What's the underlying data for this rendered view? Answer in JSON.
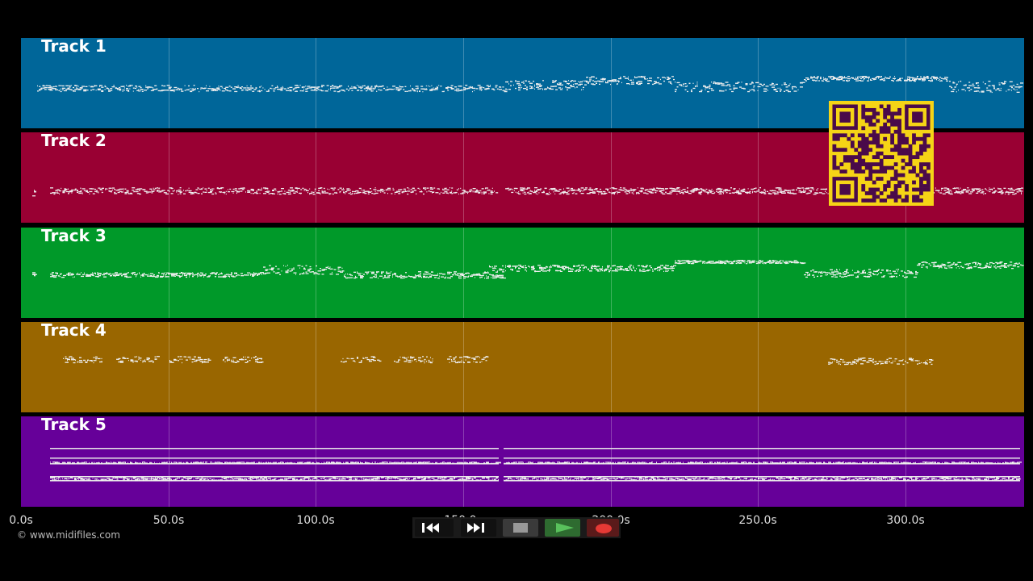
{
  "tracks": [
    {
      "label": "Track 1",
      "color": "#006699"
    },
    {
      "label": "Track 2",
      "color": "#990033"
    },
    {
      "label": "Track 3",
      "color": "#009929"
    },
    {
      "label": "Track 4",
      "color": "#996600"
    },
    {
      "label": "Track 5",
      "color": "#660099"
    }
  ],
  "timeline": {
    "ticks": [
      "0.0s",
      "50.0s",
      "100.0s",
      "150.0s",
      "200.0s",
      "250.0s",
      "300.0s"
    ]
  },
  "footer": {
    "copyright": "© www.midifiles.com"
  },
  "transport": {
    "rewind_icon": "rewind-icon",
    "forward_icon": "fast-forward-icon",
    "stop_icon": "stop-icon",
    "play_icon": "play-icon",
    "record_icon": "record-icon",
    "play_color": "#4caf50",
    "record_color": "#e53935"
  },
  "qr_code": {
    "color_fg": "#4a0a4a",
    "color_bg": "#f5d416"
  }
}
